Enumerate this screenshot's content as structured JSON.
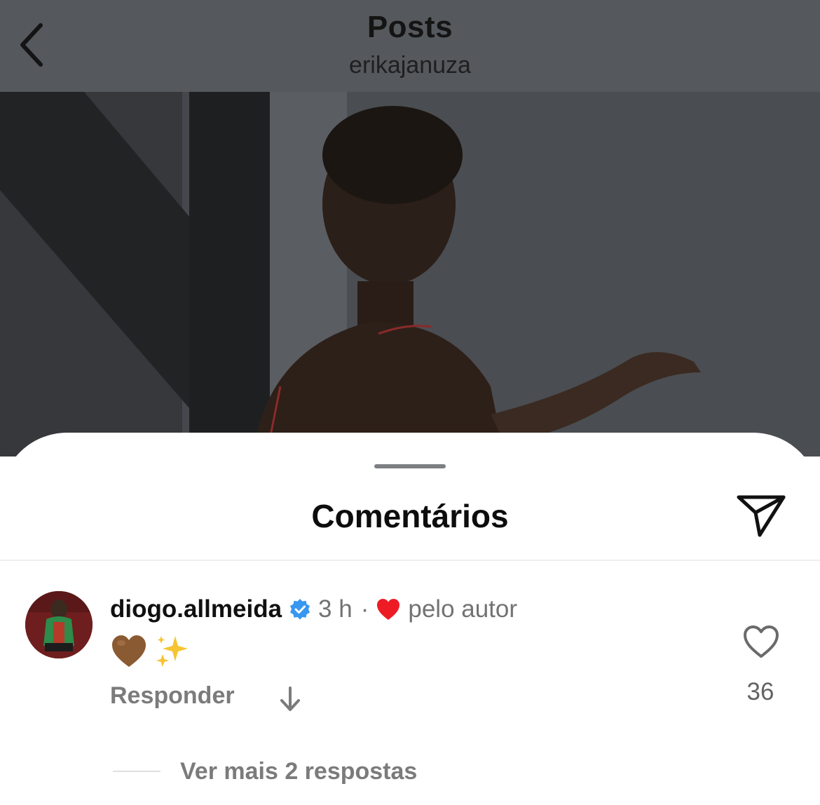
{
  "header": {
    "title": "Posts",
    "subtitle": "erikajanuza",
    "back_icon": "chevron-left-icon"
  },
  "sheet": {
    "title": "Comentários",
    "share_icon": "paper-plane-icon"
  },
  "comment": {
    "username": "diogo.allmeida",
    "verified_icon": "verified-badge-icon",
    "time": "3 h",
    "separator": "·",
    "liked_by_author_icon": "red-heart-icon",
    "liked_by_author_text": "pelo autor",
    "body": "🤎 ✨",
    "reply_label": "Responder",
    "translate_icon": "arrow-down-icon",
    "like_icon": "heart-outline-icon",
    "like_count": "36",
    "view_more_replies": "Ver mais 2 respostas"
  },
  "colors": {
    "overlay_header": "#55585c",
    "text_muted": "#737373",
    "verified_blue": "#3897f0",
    "heart_red": "#ed1c24"
  }
}
